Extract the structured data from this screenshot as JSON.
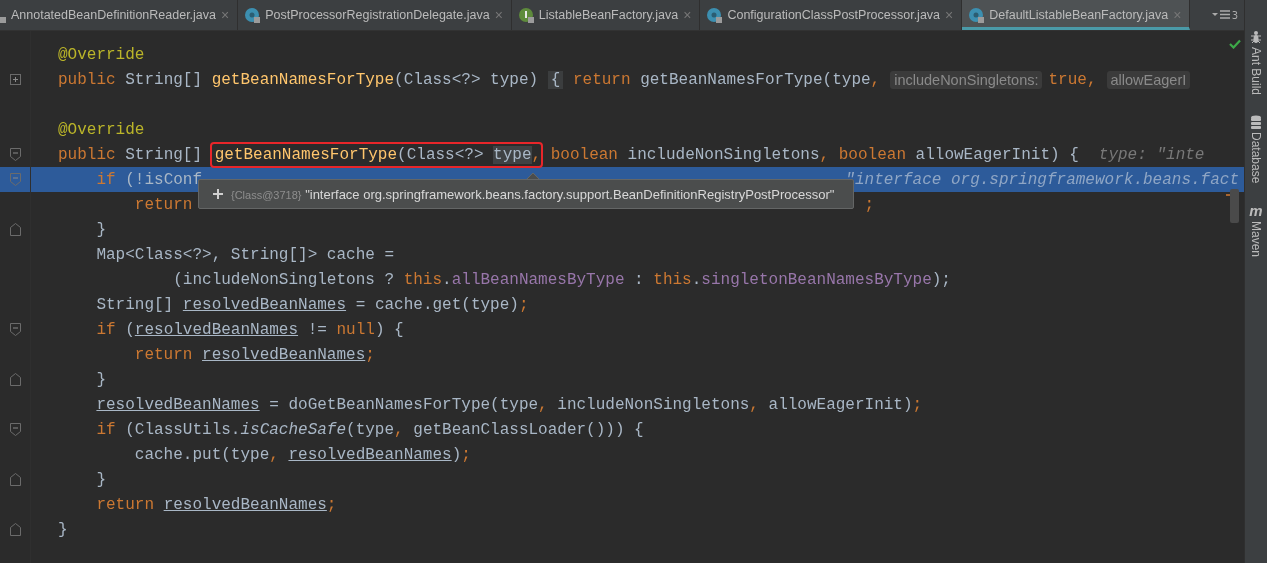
{
  "tabs": [
    {
      "label": "AnnotatedBeanDefinitionReader.java",
      "kind": "locked",
      "selected": false,
      "close": "×"
    },
    {
      "label": "PostProcessorRegistrationDelegate.java",
      "kind": "class",
      "selected": false,
      "close": "×"
    },
    {
      "label": "ListableBeanFactory.java",
      "kind": "interface",
      "selected": false,
      "close": "×"
    },
    {
      "label": "ConfigurationClassPostProcessor.java",
      "kind": "class",
      "selected": false,
      "close": "×"
    },
    {
      "label": "DefaultListableBeanFactory.java",
      "kind": "class",
      "selected": true,
      "close": "×"
    }
  ],
  "tab_overflow": {
    "count": "3"
  },
  "lines": [
    {
      "selected": false,
      "segments": [
        {
          "kind": "code",
          "tokens": [
            {
              "kind": "ann",
              "text": "@Override"
            }
          ]
        }
      ]
    },
    {
      "marker": {
        "kind": "expand"
      },
      "selected": false,
      "segments": [
        {
          "kind": "code",
          "tokens": [
            {
              "kind": "kw",
              "text": "public "
            },
            {
              "kind": "p",
              "text": "String[] "
            },
            {
              "kind": "fn",
              "text": "getBeanNamesForType"
            },
            {
              "kind": "p",
              "text": "(Class<?> type) "
            },
            {
              "kind": "fold",
              "text": "{"
            },
            {
              "kind": "kw",
              "text": " return "
            },
            {
              "kind": "p",
              "text": "getBeanNamesForType(type"
            },
            {
              "kind": "kw",
              "text": ","
            }
          ]
        },
        {
          "kind": "param_hint",
          "text": "includeNonSingletons:"
        },
        {
          "kind": "code",
          "tokens": [
            {
              "kind": "kw",
              "text": "true,"
            }
          ]
        },
        {
          "kind": "param_hint",
          "text": "allowEagerI"
        }
      ]
    },
    {
      "selected": false
    },
    {
      "selected": false,
      "segments": [
        {
          "kind": "code",
          "tokens": [
            {
              "kind": "ann",
              "text": "@Override"
            }
          ]
        }
      ]
    },
    {
      "marker": {
        "kind": "fold_start"
      },
      "selected": false,
      "segments": [
        {
          "kind": "code",
          "tokens": [
            {
              "kind": "kw",
              "text": "public "
            },
            {
              "kind": "p",
              "text": "String[] "
            }
          ]
        },
        {
          "kind": "boxed",
          "tokens": [
            {
              "kind": "fn",
              "text": "getBeanNamesForType"
            },
            {
              "kind": "p",
              "text": "(Class<?> "
            },
            {
              "kind": "hl",
              "text": "type"
            },
            {
              "kind": "kw",
              "text": ","
            }
          ]
        },
        {
          "kind": "code",
          "tokens": [
            {
              "kind": "kw",
              "text": " boolean "
            },
            {
              "kind": "p",
              "text": "includeNonSingletons"
            },
            {
              "kind": "kw",
              "text": ", boolean "
            },
            {
              "kind": "p",
              "text": "allowEagerInit) {"
            }
          ]
        },
        {
          "kind": "inline_hint",
          "text": "type: \"inte"
        }
      ]
    },
    {
      "marker": {
        "kind": "fold_start"
      },
      "selected": true,
      "segments": [
        {
          "kind": "code",
          "tokens": [
            {
              "kind": "kw",
              "text": "    if "
            },
            {
              "kind": "p",
              "text": "(!isConf"
            }
          ]
        },
        {
          "kind": "after_tooltip",
          "text": "\"interface org.springframework.beans.fact"
        }
      ]
    },
    {
      "selected": false,
      "segments": [
        {
          "kind": "code",
          "tokens": [
            {
              "kind": "kw",
              "text": "        return"
            }
          ]
        },
        {
          "kind": "after_tooltip_code",
          "tokens": [
            {
              "kind": "kw",
              "text": ";"
            }
          ]
        }
      ]
    },
    {
      "marker": {
        "kind": "fold_end"
      },
      "selected": false,
      "segments": [
        {
          "kind": "code",
          "tokens": [
            {
              "kind": "p",
              "text": "    }"
            }
          ]
        }
      ]
    },
    {
      "selected": false,
      "segments": [
        {
          "kind": "code",
          "tokens": [
            {
              "kind": "p",
              "text": "    Map<Class<?>, String[]> cache ="
            }
          ]
        }
      ]
    },
    {
      "selected": false,
      "segments": [
        {
          "kind": "code",
          "tokens": [
            {
              "kind": "p",
              "text": "            (includeNonSingletons ? "
            },
            {
              "kind": "kw",
              "text": "this"
            },
            {
              "kind": "p",
              "text": "."
            },
            {
              "kind": "fld",
              "text": "allBeanNamesByType"
            },
            {
              "kind": "p",
              "text": " : "
            },
            {
              "kind": "kw",
              "text": "this"
            },
            {
              "kind": "p",
              "text": "."
            },
            {
              "kind": "fld",
              "text": "singletonBeanNamesByType"
            },
            {
              "kind": "p",
              "text": ");"
            }
          ]
        }
      ]
    },
    {
      "selected": false,
      "segments": [
        {
          "kind": "code",
          "tokens": [
            {
              "kind": "p",
              "text": "    String[] "
            },
            {
              "kind": "u",
              "text": "resolvedBeanNames"
            },
            {
              "kind": "p",
              "text": " = cache.get(type)"
            },
            {
              "kind": "kw",
              "text": ";"
            }
          ]
        }
      ]
    },
    {
      "marker": {
        "kind": "fold_start"
      },
      "selected": false,
      "segments": [
        {
          "kind": "code",
          "tokens": [
            {
              "kind": "kw",
              "text": "    if "
            },
            {
              "kind": "p",
              "text": "("
            },
            {
              "kind": "u",
              "text": "resolvedBeanNames"
            },
            {
              "kind": "p",
              "text": " != "
            },
            {
              "kind": "kw",
              "text": "null"
            },
            {
              "kind": "p",
              "text": ") {"
            }
          ]
        }
      ]
    },
    {
      "selected": false,
      "segments": [
        {
          "kind": "code",
          "tokens": [
            {
              "kind": "kw",
              "text": "        return "
            },
            {
              "kind": "u",
              "text": "resolvedBeanNames"
            },
            {
              "kind": "kw",
              "text": ";"
            }
          ]
        }
      ]
    },
    {
      "marker": {
        "kind": "fold_end"
      },
      "selected": false,
      "segments": [
        {
          "kind": "code",
          "tokens": [
            {
              "kind": "p",
              "text": "    }"
            }
          ]
        }
      ]
    },
    {
      "selected": false,
      "segments": [
        {
          "kind": "code",
          "tokens": [
            {
              "kind": "u",
              "text": "    resolvedBeanNames"
            },
            {
              "kind": "p",
              "text": " = doGetBeanNamesForType(type"
            },
            {
              "kind": "kw",
              "text": ", "
            },
            {
              "kind": "p",
              "text": "includeNonSingletons"
            },
            {
              "kind": "kw",
              "text": ", "
            },
            {
              "kind": "p",
              "text": "allowEagerInit)"
            },
            {
              "kind": "kw",
              "text": ";"
            }
          ]
        }
      ]
    },
    {
      "marker": {
        "kind": "fold_start"
      },
      "selected": false,
      "segments": [
        {
          "kind": "code",
          "tokens": [
            {
              "kind": "kw",
              "text": "    if "
            },
            {
              "kind": "p",
              "text": "(ClassUtils."
            },
            {
              "kind": "it",
              "text": "isCacheSafe"
            },
            {
              "kind": "p",
              "text": "(type"
            },
            {
              "kind": "kw",
              "text": ", "
            },
            {
              "kind": "p",
              "text": "getBeanClassLoader())) {"
            }
          ]
        }
      ]
    },
    {
      "selected": false,
      "segments": [
        {
          "kind": "code",
          "tokens": [
            {
              "kind": "p",
              "text": "        cache.put(type"
            },
            {
              "kind": "kw",
              "text": ", "
            },
            {
              "kind": "u",
              "text": "resolvedBeanNames"
            },
            {
              "kind": "p",
              "text": ")"
            },
            {
              "kind": "kw",
              "text": ";"
            }
          ]
        }
      ]
    },
    {
      "marker": {
        "kind": "fold_end"
      },
      "selected": false,
      "segments": [
        {
          "kind": "code",
          "tokens": [
            {
              "kind": "p",
              "text": "    }"
            }
          ]
        }
      ]
    },
    {
      "selected": false,
      "segments": [
        {
          "kind": "code",
          "tokens": [
            {
              "kind": "kw",
              "text": "    return "
            },
            {
              "kind": "u",
              "text": "resolvedBeanNames"
            },
            {
              "kind": "kw",
              "text": ";"
            }
          ]
        }
      ]
    },
    {
      "marker": {
        "kind": "fold_end"
      },
      "selected": false,
      "segments": [
        {
          "kind": "code",
          "tokens": [
            {
              "kind": "p",
              "text": "}"
            }
          ]
        }
      ]
    }
  ],
  "tooltip": {
    "ref": "{Class@3718}",
    "value": "\"interface org.springframework.beans.factory.support.BeanDefinitionRegistryPostProcessor\""
  },
  "tool_windows": [
    {
      "label": "Ant Build",
      "kind": "ant"
    },
    {
      "label": "Database",
      "kind": "database"
    },
    {
      "label": "Maven",
      "kind": "maven",
      "glyph": "m"
    }
  ]
}
